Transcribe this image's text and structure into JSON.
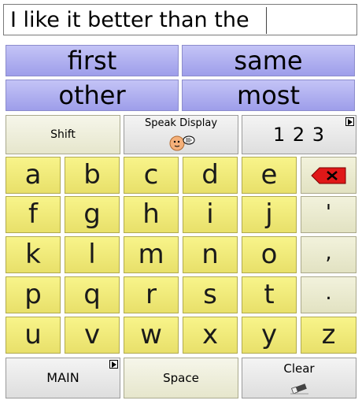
{
  "display": {
    "text": "I like it better than the"
  },
  "predictions": [
    "first",
    "same",
    "other",
    "most"
  ],
  "controls": {
    "shift": "Shift",
    "speak_display": "Speak Display",
    "numbers": "1 2 3",
    "main": "MAIN",
    "space": "Space",
    "clear": "Clear"
  },
  "letters": [
    "a",
    "b",
    "c",
    "d",
    "e",
    "f",
    "g",
    "h",
    "i",
    "j",
    "k",
    "l",
    "m",
    "n",
    "o",
    "p",
    "q",
    "r",
    "s",
    "t",
    "u",
    "v",
    "w",
    "x",
    "y",
    "z"
  ],
  "punctuation": [
    "'",
    ",",
    "."
  ],
  "icons": {
    "backspace": "backspace-icon",
    "speak": "speaking-face-icon",
    "clear": "eraser-icon",
    "more": "page-flag-icon"
  },
  "colors": {
    "prediction": "#b4b4f0",
    "letter_key": "#f0ec7a",
    "control": "#ececd8",
    "backspace_red": "#e01818"
  }
}
